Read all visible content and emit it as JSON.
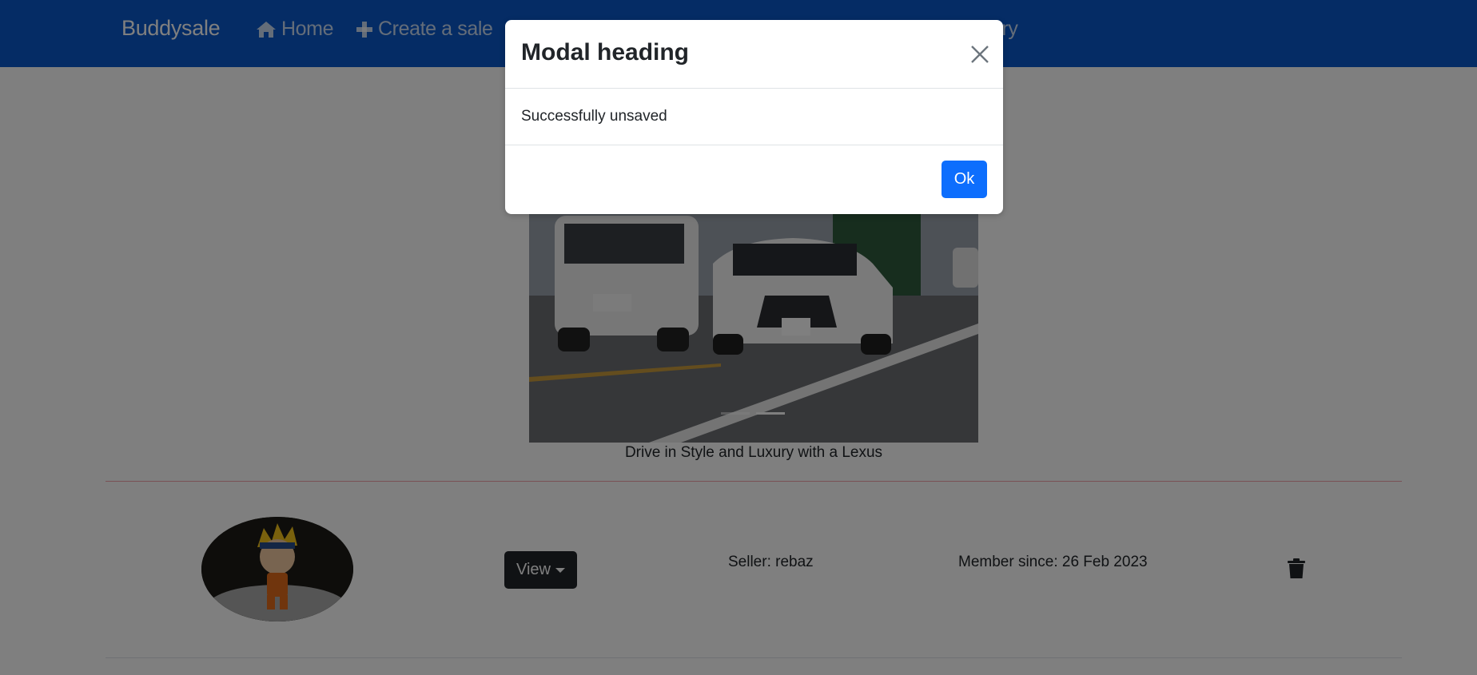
{
  "navbar": {
    "brand": "Buddysale",
    "home_label": "Home",
    "create_label": "Create a sale",
    "partial_label": "ory"
  },
  "carousel": {
    "caption": "Drive in Style and Luxury with a Lexus",
    "slide_count": 2,
    "active_slide": 2
  },
  "listing": {
    "view_label": "View",
    "seller": "Seller: rebaz",
    "member_since": "Member since: 26 Feb 2023"
  },
  "modal": {
    "title": "Modal heading",
    "message": "Successfully unsaved",
    "ok_label": "Ok"
  },
  "colors": {
    "navbar_bg": "#0a58ca",
    "primary": "#0d6efd",
    "dark": "#212529"
  },
  "icons": {
    "home": "home-icon",
    "create": "plus-icon",
    "close": "close-icon",
    "delete": "trash-icon"
  }
}
